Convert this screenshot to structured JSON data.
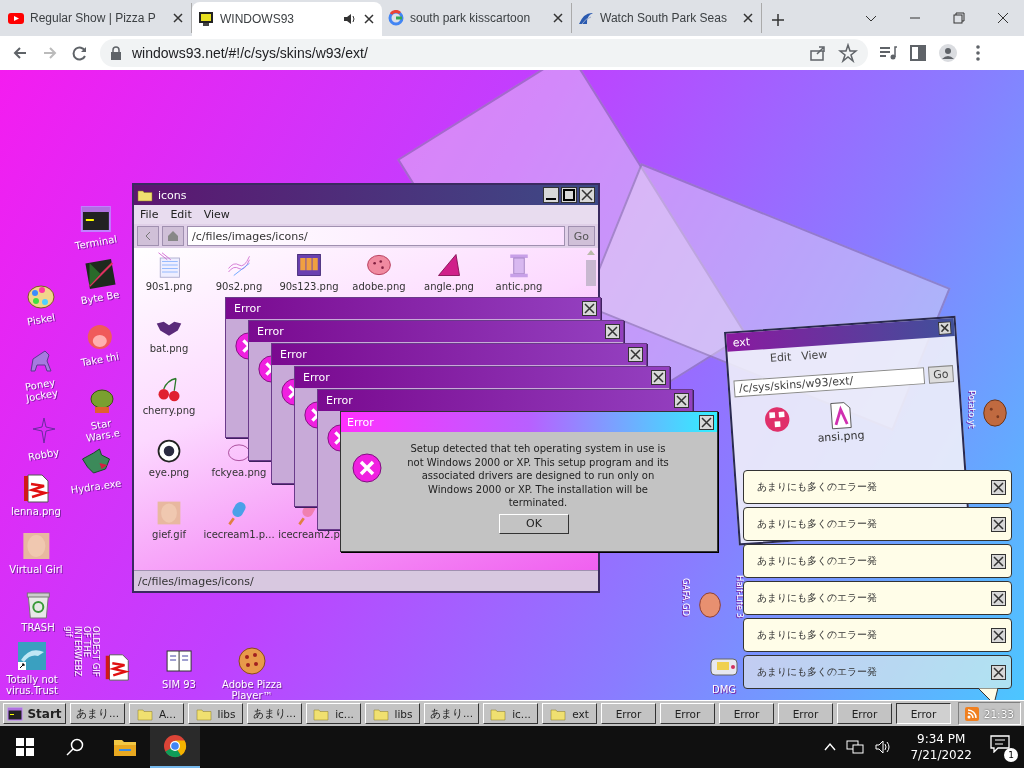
{
  "browser": {
    "tabs": [
      {
        "title": "Regular Show | Pizza P",
        "selected": false,
        "audio": false
      },
      {
        "title": "WINDOWS93",
        "selected": true,
        "audio": true
      },
      {
        "title": "south park kisscartoon",
        "selected": false,
        "audio": false
      },
      {
        "title": "Watch South Park Seas",
        "selected": false,
        "audio": false
      }
    ],
    "address": "windows93.net/#!/c/sys/skins/w93/ext/"
  },
  "desktop_icons": [
    {
      "label": "Terminal"
    },
    {
      "label": "Byte Be"
    },
    {
      "label": "Piskel"
    },
    {
      "label": "Take thi"
    },
    {
      "label": "Poney Jockey"
    },
    {
      "label": "Star Wars.e"
    },
    {
      "label": "Robby"
    },
    {
      "label": "Hydra.exe"
    },
    {
      "label": "lenna.png"
    },
    {
      "label": "Virtual Girl"
    },
    {
      "label": "TRASH"
    },
    {
      "label": "Totally not virus.Trust"
    },
    {
      "label": "OLDEST GIF OF THE INTERWEBZ gif"
    },
    {
      "label": "SIM 93"
    },
    {
      "label": "Adobe Pizza Player™"
    },
    {
      "label": "Potato.yt"
    },
    {
      "label": "GAFA.GD"
    },
    {
      "label": "Half-Life 3"
    },
    {
      "label": "DMG"
    }
  ],
  "background_window": {
    "title": "ext",
    "menu": [
      "Edit",
      "View"
    ],
    "path": "/c/sys/skins/w93/ext/",
    "go": "Go",
    "file": "ansi.png"
  },
  "explorer": {
    "title": "icons",
    "menu": [
      "File",
      "Edit",
      "View"
    ],
    "path": "/c/files/images/icons/",
    "go": "Go",
    "files": [
      {
        "name": "90s1.png"
      },
      {
        "name": "90s2.png"
      },
      {
        "name": "90s123.png"
      },
      {
        "name": "adobe.png"
      },
      {
        "name": "angle.png"
      },
      {
        "name": "antic.png"
      },
      {
        "name": "bat.png"
      },
      {
        "name": "cherry.png"
      },
      {
        "name": "eye.png"
      },
      {
        "name": "fckyea.png"
      },
      {
        "name": "gief.gif"
      },
      {
        "name": "icecream1.p..."
      },
      {
        "name": "icecream2.p"
      }
    ],
    "status": "/c/files/images/icons/"
  },
  "error_stack": [
    {
      "title": "Error"
    },
    {
      "title": "Error"
    },
    {
      "title": "Error"
    },
    {
      "title": "Error"
    },
    {
      "title": "Error"
    }
  ],
  "error_dialog": {
    "title": "Error",
    "message": "Setup detected that teh operating system in use is not Windows 2000 or XP. This setup program and its associated drivers are designed to run only on Windows 2000 or XP. The installation will be terminated.",
    "button": "OK"
  },
  "notifications": [
    {
      "text": "あまりにも多くのエラー発",
      "faded": false
    },
    {
      "text": "あまりにも多くのエラー発",
      "faded": false
    },
    {
      "text": "あまりにも多くのエラー発",
      "faded": false
    },
    {
      "text": "あまりにも多くのエラー発",
      "faded": false
    },
    {
      "text": "あまりにも多くのエラー発",
      "faded": false
    },
    {
      "text": "あまりにも多くのエラー発",
      "faded": true
    }
  ],
  "w93_taskbar": {
    "start": "Start",
    "items": [
      {
        "label": "あまり...",
        "kind": "text",
        "selected": false
      },
      {
        "label": "A...",
        "kind": "folder",
        "selected": false
      },
      {
        "label": "libs",
        "kind": "folder",
        "selected": false
      },
      {
        "label": "あまり...",
        "kind": "text",
        "selected": false
      },
      {
        "label": "ic...",
        "kind": "folder",
        "selected": false
      },
      {
        "label": "libs",
        "kind": "folder",
        "selected": false
      },
      {
        "label": "あまり...",
        "kind": "text",
        "selected": false
      },
      {
        "label": "ic...",
        "kind": "folder",
        "selected": false
      },
      {
        "label": "ext",
        "kind": "folder",
        "selected": false
      },
      {
        "label": "Error",
        "kind": "text",
        "selected": false
      },
      {
        "label": "Error",
        "kind": "text",
        "selected": false
      },
      {
        "label": "Error",
        "kind": "text",
        "selected": false
      },
      {
        "label": "Error",
        "kind": "text",
        "selected": false
      },
      {
        "label": "Error",
        "kind": "text",
        "selected": false
      },
      {
        "label": "Error",
        "kind": "text",
        "selected": true
      }
    ],
    "clock": "21:33"
  },
  "win_taskbar": {
    "time": "9:34 PM",
    "date": "7/21/2022",
    "notifications": "1"
  }
}
